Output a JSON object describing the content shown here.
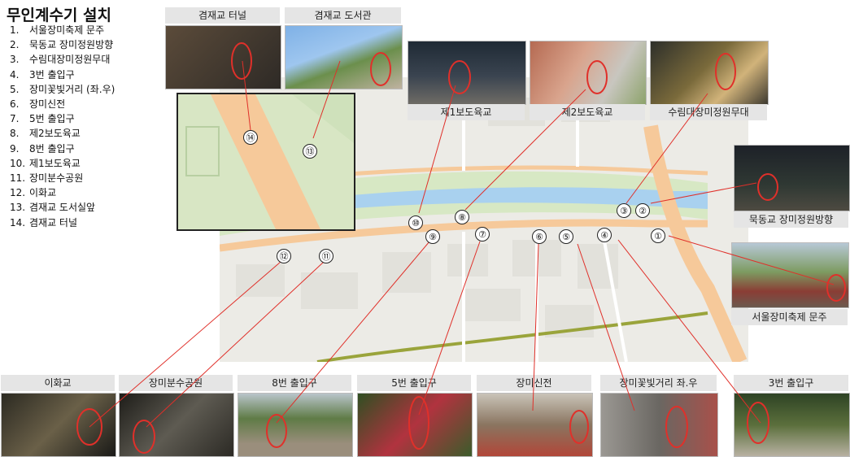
{
  "title": "무인계수기 설치",
  "locations": [
    {
      "num": "1.",
      "name": "서울장미축제 문주"
    },
    {
      "num": "2.",
      "name": "묵동교 장미정원방향"
    },
    {
      "num": "3.",
      "name": "수림대장미정원무대"
    },
    {
      "num": "4.",
      "name": "3번 출입구"
    },
    {
      "num": "5.",
      "name": "장미꽃빛거리 (좌.우)"
    },
    {
      "num": "6.",
      "name": "장미신전"
    },
    {
      "num": "7.",
      "name": "5번 출입구"
    },
    {
      "num": "8.",
      "name": "제2보도육교"
    },
    {
      "num": "9.",
      "name": "8번 출입구"
    },
    {
      "num": "10.",
      "name": "제1보도육교"
    },
    {
      "num": "11.",
      "name": "장미분수공원"
    },
    {
      "num": "12.",
      "name": "이화교"
    },
    {
      "num": "13.",
      "name": "겸재교 도서실앞"
    },
    {
      "num": "14.",
      "name": "겸재교 터널"
    }
  ],
  "captions": {
    "tunnel": "겸재교 터널",
    "library": "겸재교 도서관",
    "bridge1": "제1보도육교",
    "bridge2": "제2보도육교",
    "surimdae": "수림대장미정원무대",
    "mukdong": "묵동교 장미정원방향",
    "festival": "서울장미축제 문주",
    "ihwa": "이화교",
    "fountain": "장미분수공원",
    "exit8": "8번 출입구",
    "exit5": "5번 출입구",
    "shrine": "장미신전",
    "lights": "장미꽃빛거리 좌.우",
    "exit3": "3번 출입구"
  },
  "markers": [
    "①",
    "②",
    "③",
    "④",
    "⑤",
    "⑥",
    "⑦",
    "⑧",
    "⑨",
    "⑩",
    "⑪",
    "⑫",
    "⑬",
    "⑭"
  ],
  "colors": {
    "river": "#a9d1ef",
    "park": "#d7e8c4",
    "road": "#f6c99a",
    "pointer": "#e0302a",
    "rail": "#9aa43b"
  }
}
